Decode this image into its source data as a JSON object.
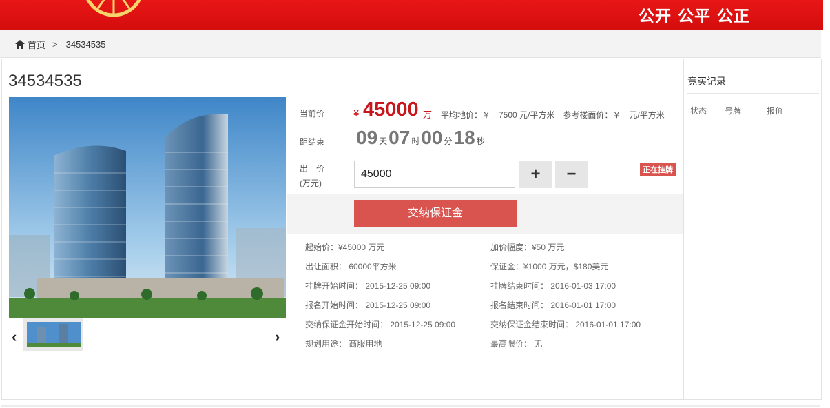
{
  "header": {
    "slogan": "公开 公平 公正"
  },
  "breadcrumb": {
    "home": "首页",
    "separator": ">",
    "current": "34534535"
  },
  "listing": {
    "title": "34534535"
  },
  "bid_panel": {
    "current_price_label": "当前价",
    "currency_symbol": "¥",
    "current_price": "45000",
    "price_unit": "万",
    "avg_price_text": "平均地价：￥　7500 元/平方米　参考楼面价：￥　元/平方米",
    "countdown_label": "距结束",
    "countdown": {
      "days": "09",
      "days_unit": "天",
      "hours": "07",
      "hours_unit": "时",
      "minutes": "00",
      "minutes_unit": "分",
      "seconds": "18",
      "seconds_unit": "秒"
    },
    "bid_label_line1": "出　价",
    "bid_label_line2": "(万元)",
    "bid_value": "45000",
    "plus_label": "+",
    "minus_label": "−",
    "status_badge": "正在挂牌",
    "deposit_button": "交纳保证金"
  },
  "details": {
    "left": [
      "起始价：¥45000 万元",
      "出让面积： 60000平方米",
      "挂牌开始时间： 2015-12-25 09:00",
      "报名开始时间： 2015-12-25 09:00",
      "交纳保证金开始时间： 2015-12-25 09:00",
      "规划用途： 商服用地"
    ],
    "right": [
      "加价幅度：¥50 万元",
      "保证金：¥1000 万元，$180美元",
      "挂牌结束时间： 2016-01-03 17:00",
      "报名结束时间： 2016-01-01 17:00",
      "交纳保证金结束时间： 2016-01-01 17:00",
      "最高限价： 无"
    ]
  },
  "bid_records": {
    "title": "竟买记录",
    "columns": [
      "状态",
      "号牌",
      "报价"
    ]
  },
  "colors": {
    "brand_red": "#e31414",
    "price_red": "#c8161d",
    "button_red": "#d9534f"
  },
  "icons": {
    "home": "home-icon",
    "prev": "chevron-left-icon",
    "next": "chevron-right-icon"
  }
}
